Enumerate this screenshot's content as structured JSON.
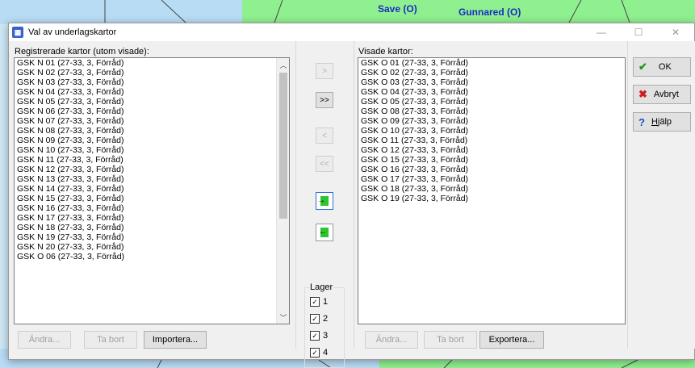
{
  "map": {
    "labels": [
      "Save (O)",
      "Gunnared (O)"
    ]
  },
  "dialog": {
    "title": "Val av underlagskartor",
    "app_icon": "map-app-icon",
    "window_controls": [
      "minimize-icon",
      "maximize-icon",
      "close-icon"
    ],
    "left": {
      "label": "Registrerade kartor (utom visade):",
      "items": [
        "GSK N 01 (27-33, 3, Förråd)",
        "GSK N 02 (27-33, 3, Förråd)",
        "GSK N 03 (27-33, 3, Förråd)",
        "GSK N 04 (27-33, 3, Förråd)",
        "GSK N 05 (27-33, 3, Förråd)",
        "GSK N 06 (27-33, 3, Förråd)",
        "GSK N 07 (27-33, 3, Förråd)",
        "GSK N 08 (27-33, 3, Förråd)",
        "GSK N 09 (27-33, 3, Förråd)",
        "GSK N 10 (27-33, 3, Förråd)",
        "GSK N 11 (27-33, 3, Förråd)",
        "GSK N 12 (27-33, 3, Förråd)",
        "GSK N 13 (27-33, 3, Förråd)",
        "GSK N 14 (27-33, 3, Förråd)",
        "GSK N 15 (27-33, 3, Förråd)",
        "GSK N 16 (27-33, 3, Förråd)",
        "GSK N 17 (27-33, 3, Förråd)",
        "GSK N 18 (27-33, 3, Förråd)",
        "GSK N 19 (27-33, 3, Förråd)",
        "GSK N 20 (27-33, 3, Förråd)",
        "GSK O 06 (27-33, 3, Förråd)"
      ],
      "buttons": {
        "edit": "Ändra...",
        "delete": "Ta bort",
        "import": "Importera..."
      }
    },
    "middle": {
      "add": ">",
      "add_all": ">>",
      "remove": "<",
      "remove_all": "<<",
      "move_in_icon": "arrow-right-icon",
      "move_out_icon": "arrow-left-icon",
      "lager": {
        "title": "Lager",
        "items": [
          {
            "label": "1",
            "checked": "✓"
          },
          {
            "label": "2",
            "checked": "✓"
          },
          {
            "label": "3",
            "checked": "✓"
          },
          {
            "label": "4",
            "checked": "✓"
          }
        ]
      }
    },
    "right": {
      "label": "Visade kartor:",
      "items": [
        "GSK O 01 (27-33, 3, Förråd)",
        "GSK O 02 (27-33, 3, Förråd)",
        "GSK O 03 (27-33, 3, Förråd)",
        "GSK O 04 (27-33, 3, Förråd)",
        "GSK O 05 (27-33, 3, Förråd)",
        "GSK O 08 (27-33, 3, Förråd)",
        "GSK O 09 (27-33, 3, Förråd)",
        "GSK O 10 (27-33, 3, Förråd)",
        "GSK O 11 (27-33, 3, Förråd)",
        "GSK O 12 (27-33, 3, Förråd)",
        "GSK O 15 (27-33, 3, Förråd)",
        "GSK O 16 (27-33, 3, Förråd)",
        "GSK O 17 (27-33, 3, Förråd)",
        "GSK O 18 (27-33, 3, Förråd)",
        "GSK O 19 (27-33, 3, Förråd)"
      ],
      "buttons": {
        "edit": "Ändra...",
        "delete": "Ta bort",
        "export": "Exportera..."
      }
    },
    "actions": {
      "ok": "OK",
      "cancel": "Avbryt",
      "help": "Hjälp",
      "ok_icon": "✔",
      "cancel_icon": "✖",
      "help_icon": "?"
    }
  }
}
